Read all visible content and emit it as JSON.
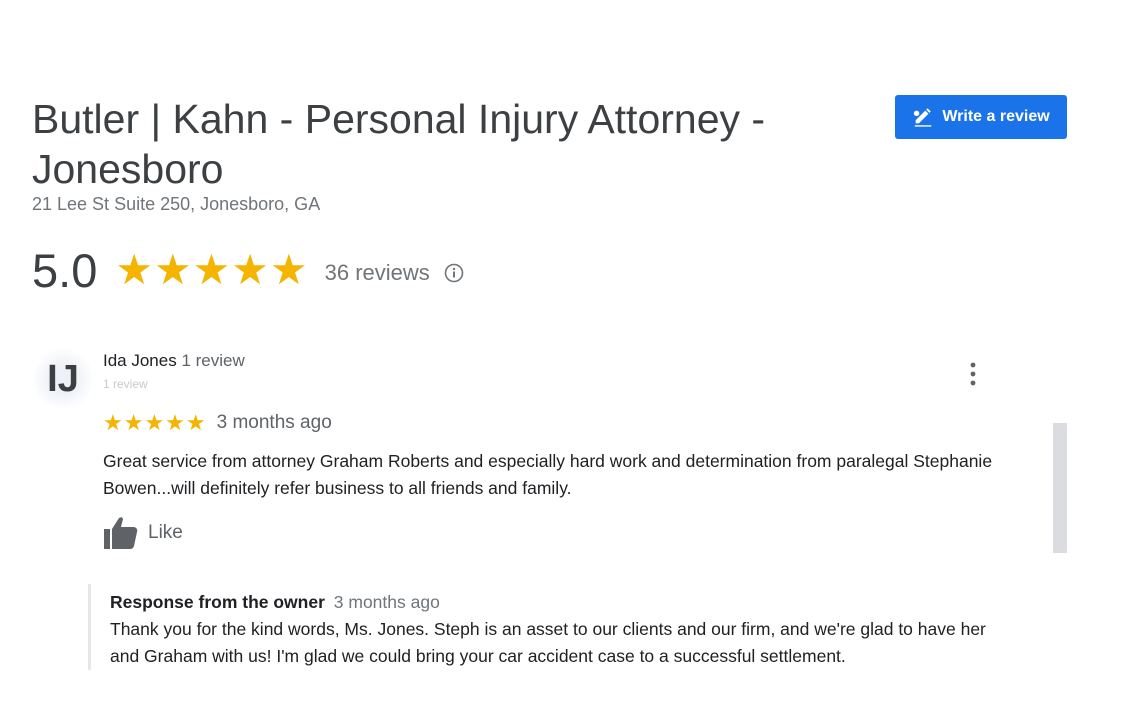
{
  "business": {
    "name": "Butler | Kahn - Personal Injury Attorney - Jonesboro",
    "address": "21 Lee St Suite 250, Jonesboro, GA"
  },
  "actions": {
    "write_review_label": "Write a review",
    "write_review_icon": "pencil-icon"
  },
  "rating": {
    "value": "5.0",
    "stars": "★★★★★",
    "star_count": 5,
    "review_count_label": "36 reviews",
    "info_icon": "info-icon",
    "star_color": "#f4b400"
  },
  "reviews": [
    {
      "avatar_initials": "IJ",
      "name": "Ida Jones",
      "meta": "1 review",
      "sub_meta": "1 review",
      "stars": "★★★★★",
      "rating": 5,
      "date": "3 months ago",
      "text": "Great service from attorney Graham Roberts and especially hard work and determination from paralegal Stephanie Bowen...will definitely refer business to all friends and family.",
      "like_label": "Like",
      "more_icon": "more-vert-icon",
      "owner_response": {
        "label": "Response from the owner",
        "date": "3 months ago",
        "text": "Thank you for the kind words, Ms. Jones. Steph is an asset to our clients and our firm, and we're glad to have her and Graham with us! I'm glad we could bring your car accident case to a successful settlement."
      }
    }
  ],
  "colors": {
    "accent": "#1a73e8",
    "star": "#f4b400",
    "muted_text": "#70757a"
  }
}
